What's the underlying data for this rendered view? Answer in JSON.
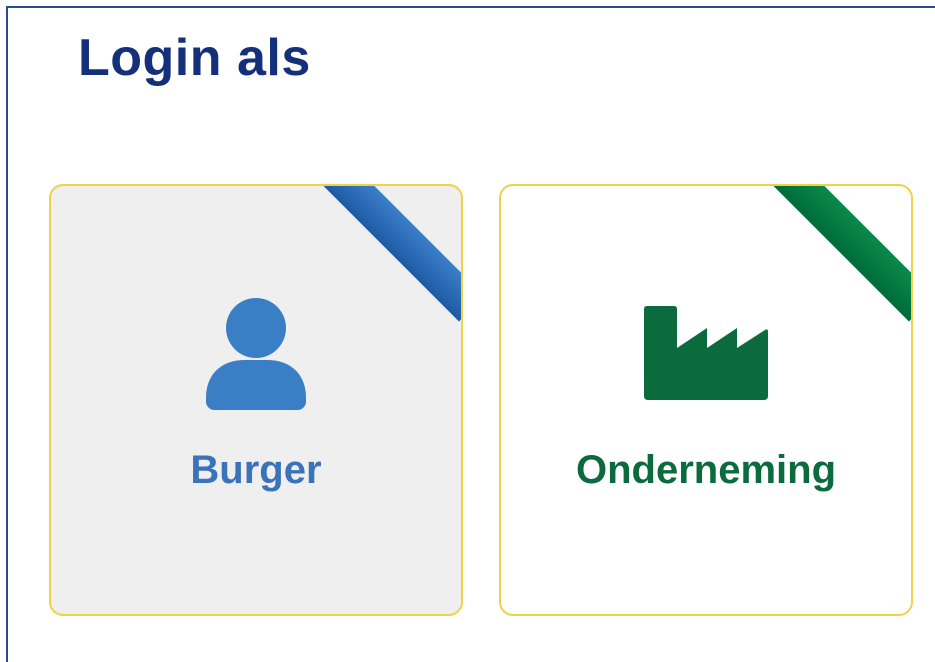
{
  "page": {
    "title": "Login als"
  },
  "cards": [
    {
      "label": "Burger",
      "icon": "user-icon",
      "accent_color": "#3a7ec6",
      "background": "#efefef"
    },
    {
      "label": "Onderneming",
      "icon": "factory-icon",
      "accent_color": "#0b6b3d",
      "background": "#ffffff"
    }
  ],
  "colors": {
    "title": "#15307a",
    "card_border": "#f0d24a",
    "frame_border": "#2a4c8f"
  }
}
